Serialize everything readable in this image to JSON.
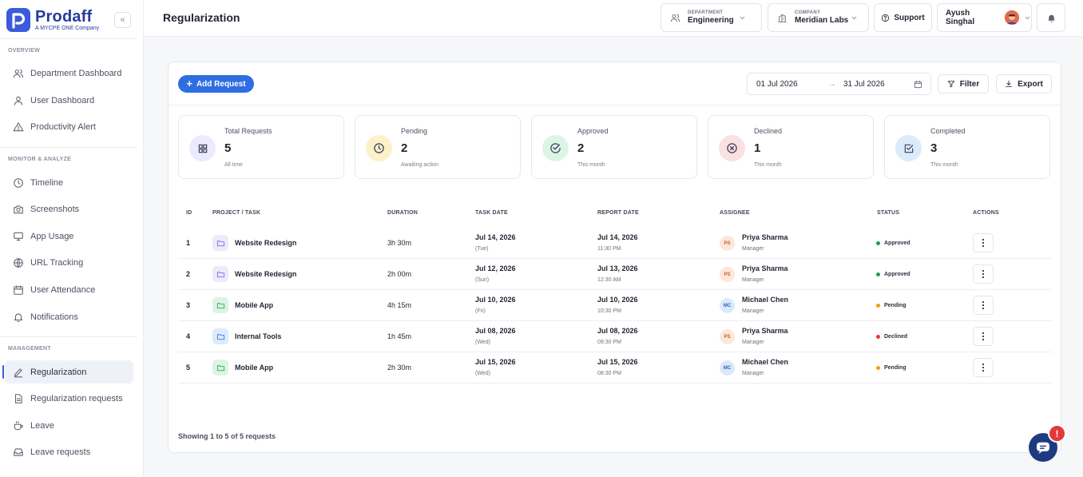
{
  "brand": {
    "name": "Prodaff",
    "tagline": "A MYCPE ONE Company",
    "color": "#3b5bdb"
  },
  "sidebar": {
    "collapse_label": "«",
    "sections": [
      {
        "title": "OVERVIEW",
        "items": [
          {
            "label": "Department Dashboard",
            "icon": "users-icon"
          },
          {
            "label": "User Dashboard",
            "icon": "user-icon"
          },
          {
            "label": "Productivity Alert",
            "icon": "alert-triangle-icon"
          }
        ]
      },
      {
        "title": "MONITOR & ANALYZE",
        "items": [
          {
            "label": "Timeline",
            "icon": "clock-icon"
          },
          {
            "label": "Screenshots",
            "icon": "camera-icon"
          },
          {
            "label": "App Usage",
            "icon": "monitor-icon"
          },
          {
            "label": "URL Tracking",
            "icon": "globe-icon"
          },
          {
            "label": "User Attendance",
            "icon": "calendar-icon"
          },
          {
            "label": "Notifications",
            "icon": "bell-icon"
          }
        ]
      },
      {
        "title": "MANAGEMENT",
        "items": [
          {
            "label": "Regularization",
            "icon": "pencil-icon",
            "active": true
          },
          {
            "label": "Regularization requests",
            "icon": "file-icon"
          },
          {
            "label": "Leave",
            "icon": "coffee-icon"
          },
          {
            "label": "Leave requests",
            "icon": "inbox-icon"
          }
        ]
      }
    ]
  },
  "header": {
    "title": "Regularization",
    "department": {
      "label": "DEPARTMENT",
      "value": "Engineering"
    },
    "company": {
      "label": "COMPANY",
      "value": "Meridian Labs"
    },
    "support_label": "Support",
    "user_name": "Ayush Singhal"
  },
  "toolbar": {
    "add_label": "Add Request",
    "date_from": "01 Jul 2026",
    "date_arrow": "→",
    "date_to": "31 Jul 2026",
    "filter_label": "Filter",
    "export_label": "Export"
  },
  "stats": [
    {
      "label": "Total Requests",
      "value": "5",
      "sub": "All time",
      "icon": "grid-icon",
      "bg": "#eceafd",
      "fg": "#3a3f55"
    },
    {
      "label": "Pending",
      "value": "2",
      "sub": "Awaiting action",
      "icon": "clock-icon",
      "bg": "#fdf1c9",
      "fg": "#3a3f55"
    },
    {
      "label": "Approved",
      "value": "2",
      "sub": "This month",
      "icon": "check-circle-icon",
      "bg": "#ddf5e4",
      "fg": "#3a3f55"
    },
    {
      "label": "Declined",
      "value": "1",
      "sub": "This month",
      "icon": "x-circle-icon",
      "bg": "#fbe1e1",
      "fg": "#3a3f55"
    },
    {
      "label": "Completed",
      "value": "3",
      "sub": "This month",
      "icon": "check-square-icon",
      "bg": "#dcebfb",
      "fg": "#3a3f55"
    }
  ],
  "table": {
    "headers": [
      "ID",
      "PROJECT / TASK",
      "DURATION",
      "TASK DATE",
      "REPORT DATE",
      "ASSIGNEE",
      "STATUS",
      "ACTIONS"
    ],
    "rows": [
      {
        "id": "1",
        "project": "Website Redesign",
        "folder_color": "#7c6fe0",
        "folder_bg": "#ecebfb",
        "duration": "3h 30m",
        "task_date": "Jul 14, 2026",
        "task_day": "(Tue)",
        "report_date": "Jul 14, 2026",
        "report_time": "11:30 PM",
        "assignee": "Priya Sharma",
        "role": "Manager",
        "initials": "PS",
        "av_bg": "#fde7d9",
        "av_fg": "#c2602d",
        "status": "Approved",
        "status_color": "#1e9e55"
      },
      {
        "id": "2",
        "project": "Website Redesign",
        "folder_color": "#7c6fe0",
        "folder_bg": "#ecebfb",
        "duration": "2h 00m",
        "task_date": "Jul 12, 2026",
        "task_day": "(Sun)",
        "report_date": "Jul 13, 2026",
        "report_time": "12:30 AM",
        "assignee": "Priya Sharma",
        "role": "Manager",
        "initials": "PS",
        "av_bg": "#fde7d9",
        "av_fg": "#c2602d",
        "status": "Approved",
        "status_color": "#1e9e55"
      },
      {
        "id": "3",
        "project": "Mobile App",
        "folder_color": "#2ea85a",
        "folder_bg": "#dcf4e3",
        "duration": "4h 15m",
        "task_date": "Jul 10, 2026",
        "task_day": "(Fri)",
        "report_date": "Jul 10, 2026",
        "report_time": "10:30 PM",
        "assignee": "Michael Chen",
        "role": "Manager",
        "initials": "MC",
        "av_bg": "#dbe9fb",
        "av_fg": "#2f62b8",
        "status": "Pending",
        "status_color": "#f59e0b"
      },
      {
        "id": "4",
        "project": "Internal Tools",
        "folder_color": "#3b82d6",
        "folder_bg": "#dcebfb",
        "duration": "1h 45m",
        "task_date": "Jul 08, 2026",
        "task_day": "(Wed)",
        "report_date": "Jul 08, 2026",
        "report_time": "09:30 PM",
        "assignee": "Priya Sharma",
        "role": "Manager",
        "initials": "PS",
        "av_bg": "#fde7d9",
        "av_fg": "#c2602d",
        "status": "Declined",
        "status_color": "#e5383b"
      },
      {
        "id": "5",
        "project": "Mobile App",
        "folder_color": "#2ea85a",
        "folder_bg": "#dcf4e3",
        "duration": "2h 30m",
        "task_date": "Jul 15, 2026",
        "task_day": "(Wed)",
        "report_date": "Jul 15, 2026",
        "report_time": "08:30 PM",
        "assignee": "Michael Chen",
        "role": "Manager",
        "initials": "MC",
        "av_bg": "#dbe9fb",
        "av_fg": "#2f62b8",
        "status": "Pending",
        "status_color": "#f59e0b"
      }
    ]
  },
  "footer_text": "Showing 1 to 5 of 5 requests",
  "chat_badge": "!"
}
